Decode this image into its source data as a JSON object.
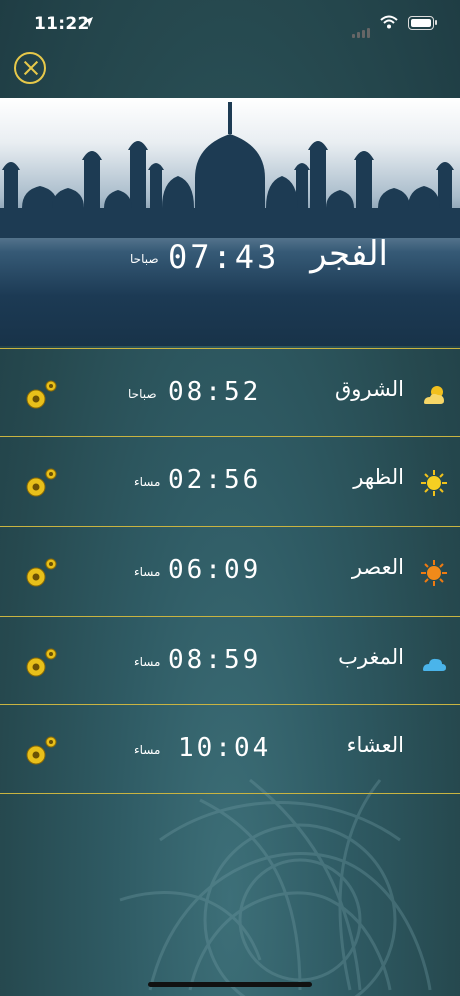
{
  "status_bar": {
    "time": "11:22"
  },
  "current_prayer": {
    "name": "الفجر",
    "time": "07:43",
    "period": "صباحا"
  },
  "prayers": [
    {
      "name": "الشروق",
      "time": "08:52",
      "period": "صباحا",
      "icon": "partly-cloudy-icon"
    },
    {
      "name": "الظهر",
      "time": "02:56",
      "period": "مساء",
      "icon": "sun-icon"
    },
    {
      "name": "العصر",
      "time": "06:09",
      "period": "مساء",
      "icon": "orange-sun-icon"
    },
    {
      "name": "المغرب",
      "time": "08:59",
      "period": "مساء",
      "icon": "cloud-icon"
    },
    {
      "name": "العشاء",
      "time": "10:04",
      "period": "مساء",
      "icon": "crescent-moon-icon"
    }
  ],
  "colors": {
    "accent": "#e6c84a",
    "divider": "#c9b441",
    "background": "#2c5560"
  }
}
